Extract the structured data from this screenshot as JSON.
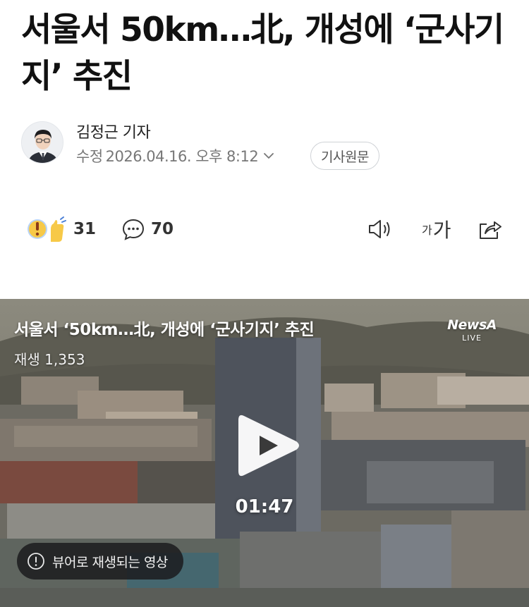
{
  "article": {
    "headline": "서울서 50km…北, 개성에 ‘군사기지’ 추진"
  },
  "byline": {
    "author": "김정근 기자",
    "modified_label": "수정",
    "modified_datetime": "2026.04.16. 오후 8:12",
    "original_button": "기사원문",
    "icons": [
      "avatar",
      "chevron-down-icon"
    ]
  },
  "actions": {
    "reaction_count": "31",
    "comment_count": "70",
    "font_small": "가",
    "font_large": "가",
    "icons": [
      "reaction-icon",
      "comment-icon",
      "speaker-icon",
      "share-icon"
    ]
  },
  "video": {
    "title": "서울서 ‘50km…北, 개성에 ‘군사기지’ 추진",
    "views": "재생 1,353",
    "logo_brand": "NewsA",
    "logo_sub": "LIVE",
    "duration": "01:47",
    "notice": "뷰어로 재생되는 영상",
    "icons": [
      "play-icon",
      "info-icon"
    ]
  },
  "colors": {
    "text_primary": "#111111",
    "text_secondary": "#777777",
    "notice_bg": "#1c1c1e"
  }
}
